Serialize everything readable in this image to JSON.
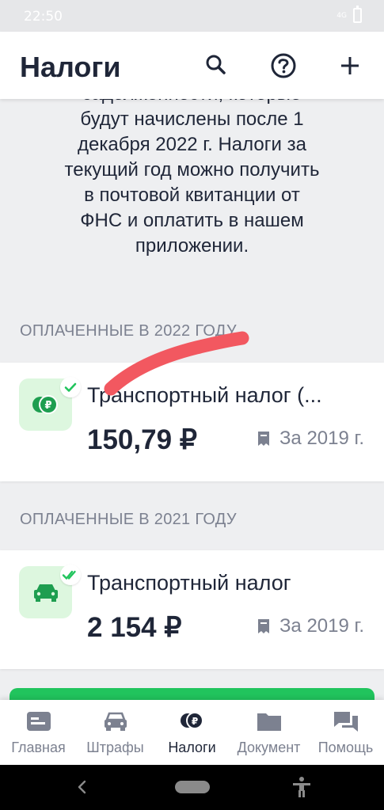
{
  "status_bar": {
    "time": "22:50",
    "signal": "4G"
  },
  "header": {
    "title": "Налоги"
  },
  "info": {
    "lines": [
      "задолженности, которые",
      "будут начислены после 1",
      "декабря 2022 г. Налоги за",
      "текущий год можно получить",
      "в почтовой квитанции от",
      "ФНС и оплатить в нашем",
      "приложении."
    ]
  },
  "sections": [
    {
      "title": "ОПЛАЧЕННЫЕ В 2022 ГОДУ",
      "card": {
        "icon": "ruble-coins-icon",
        "badge": "check-icon",
        "title": "Транспортный налог (...",
        "amount": "150,79 ₽",
        "period": "За 2019 г."
      }
    },
    {
      "title": "ОПЛАЧЕННЫЕ В 2021 ГОДУ",
      "card": {
        "icon": "car-icon",
        "badge": "double-check-icon",
        "title": "Транспортный налог",
        "amount": "2 154 ₽",
        "period": "За 2019 г."
      }
    }
  ],
  "bottom_nav": [
    {
      "label": "Главная",
      "icon": "home-card-icon",
      "active": false
    },
    {
      "label": "Штрафы",
      "icon": "car-icon",
      "active": false
    },
    {
      "label": "Налоги",
      "icon": "ruble-coins-icon",
      "active": true
    },
    {
      "label": "Документ",
      "icon": "folder-icon",
      "active": false
    },
    {
      "label": "Помощь",
      "icon": "chat-icon",
      "active": false
    }
  ],
  "colors": {
    "accent": "#21c45d",
    "text": "#1f2638",
    "muted": "#7c8190",
    "background": "#eeeff1",
    "tile": "#ddf7df",
    "scribble": "#f25860"
  }
}
